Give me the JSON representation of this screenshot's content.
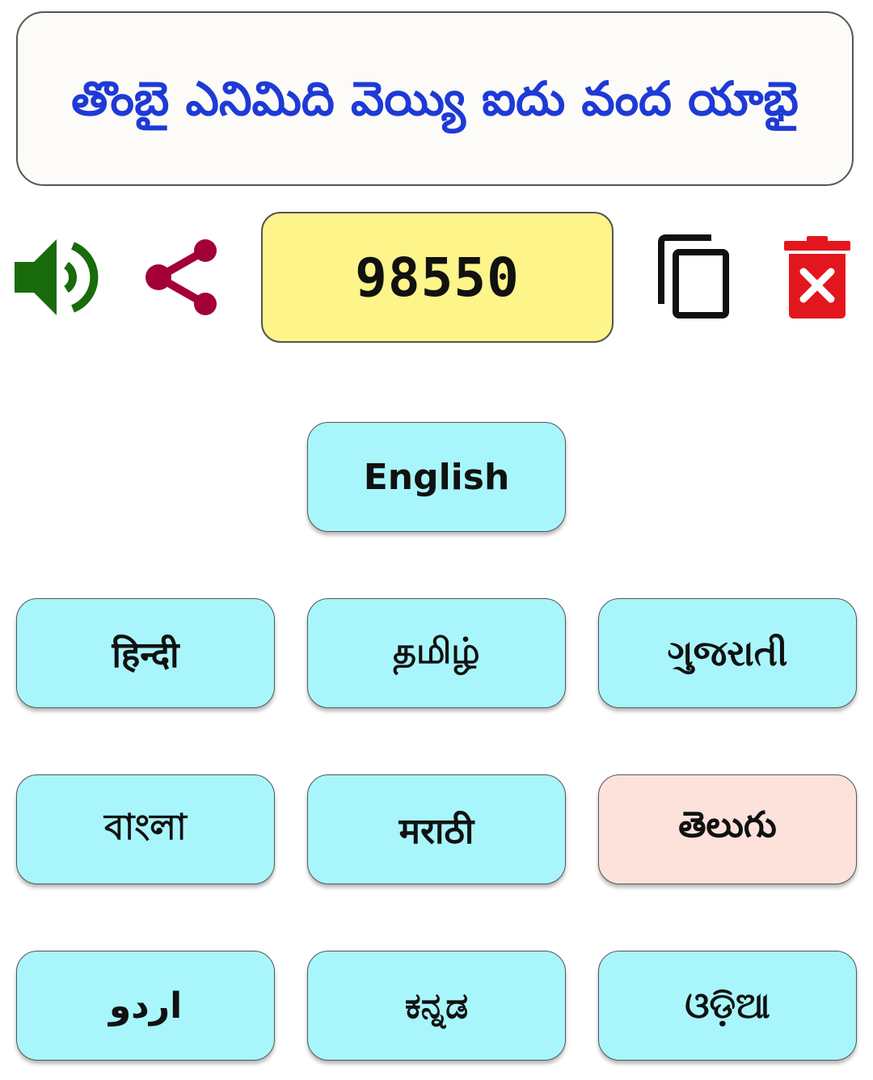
{
  "words": {
    "text": "తొంబై ఎనిమిది వెయ్యి ఐదు వంద యాభై",
    "color": "#1e3ad6"
  },
  "number": {
    "value": "98550",
    "background": "#fdf48a"
  },
  "icons": {
    "speaker": "speaker-icon",
    "share": "share-icon",
    "copy": "copy-icon",
    "delete": "delete-icon"
  },
  "colors": {
    "speaker": "#1a6b0c",
    "share": "#a3003a",
    "delete": "#e3161d",
    "language_button": "#a8f6fb",
    "language_button_active": "#fde2dc"
  },
  "languages": {
    "english": "English",
    "hindi": "हिन्दी",
    "tamil": "தமிழ்",
    "gujarati": "ગુજરાતી",
    "bangla": "বাংলা",
    "marathi": "मराठी",
    "telugu": "తెలుగు",
    "urdu": "اردو",
    "kannada": "ಕನ್ನಡ",
    "odia": "ଓଡ଼ିଆ"
  },
  "selected_language": "telugu"
}
